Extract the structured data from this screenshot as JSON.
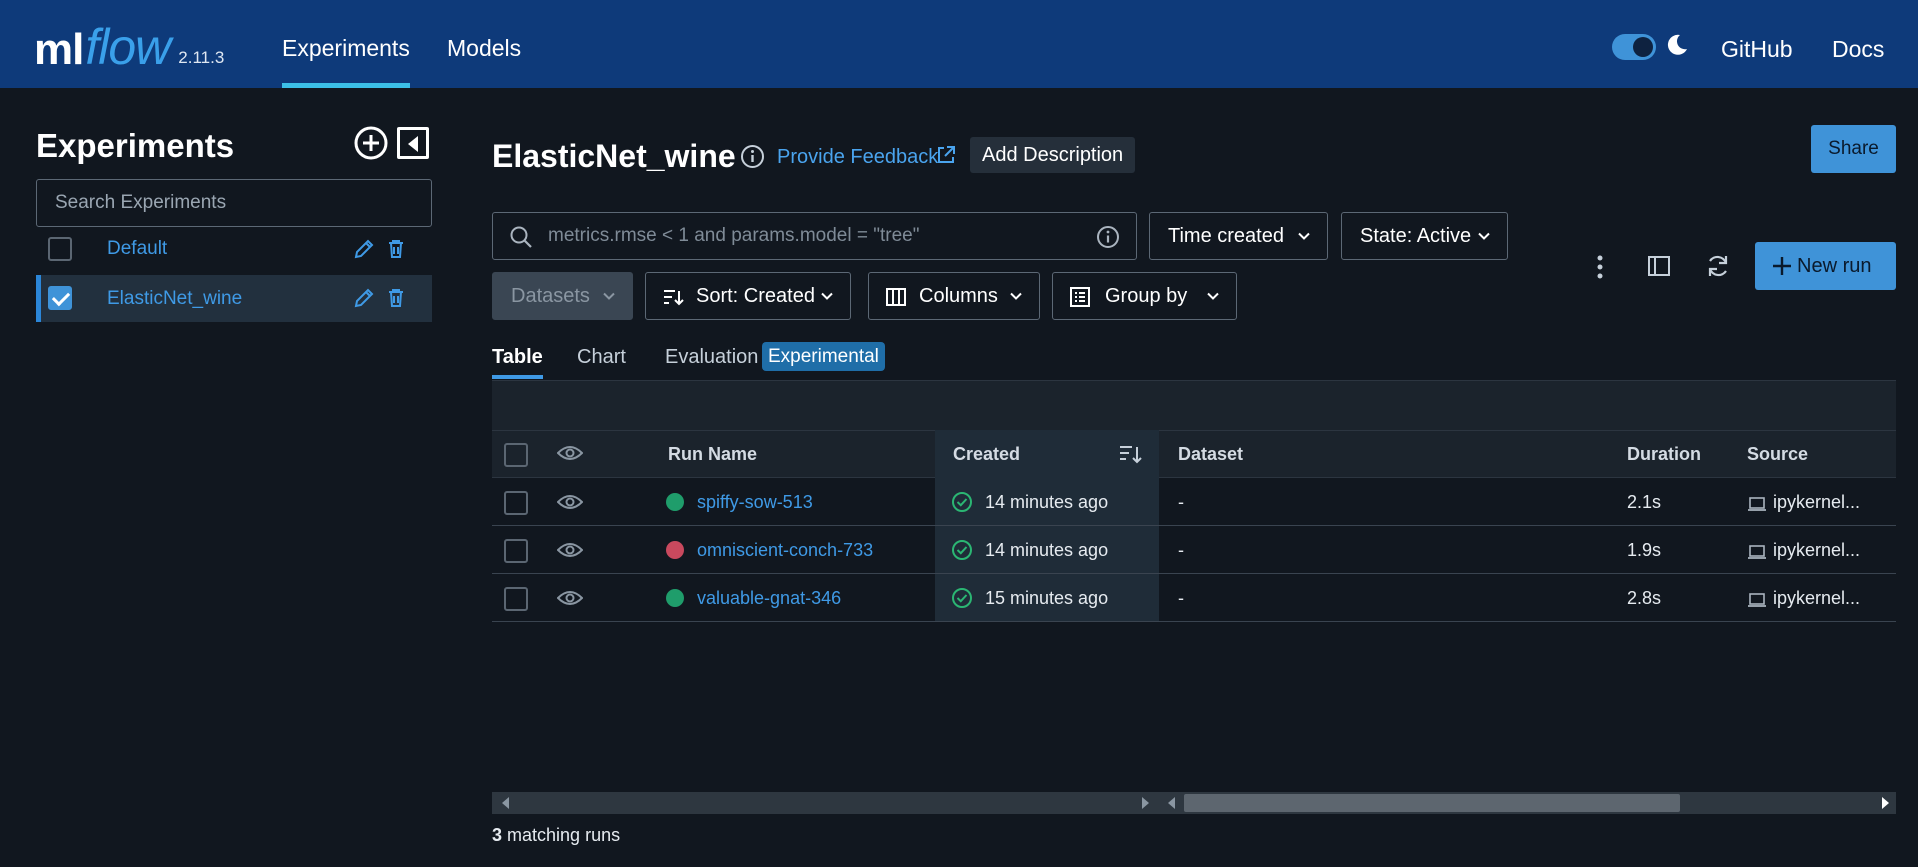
{
  "header": {
    "logo_ml": "ml",
    "logo_flow": "flow",
    "version": "2.11.3",
    "nav": [
      {
        "label": "Experiments",
        "active": true
      },
      {
        "label": "Models",
        "active": false
      }
    ],
    "dark_mode_toggle": true,
    "links": [
      {
        "label": "GitHub"
      },
      {
        "label": "Docs"
      }
    ]
  },
  "sidebar": {
    "title": "Experiments",
    "search_placeholder": "Search Experiments",
    "experiments": [
      {
        "name": "Default",
        "checked": false,
        "selected": false
      },
      {
        "name": "ElasticNet_wine",
        "checked": true,
        "selected": true
      }
    ]
  },
  "main": {
    "title": "ElasticNet_wine",
    "feedback_label": "Provide Feedback",
    "add_description_label": "Add Description",
    "share_label": "Share",
    "search_placeholder": "metrics.rmse < 1 and params.model = \"tree\"",
    "filters": {
      "time_created": "Time created",
      "state": "State: Active",
      "datasets": "Datasets",
      "sort": "Sort: Created",
      "columns": "Columns",
      "group_by": "Group by"
    },
    "new_run_label": "New run",
    "tabs": [
      {
        "label": "Table",
        "active": true
      },
      {
        "label": "Chart",
        "active": false
      },
      {
        "label": "Evaluation",
        "active": false
      }
    ],
    "experimental_badge": "Experimental",
    "table": {
      "columns": [
        "Run Name",
        "Created",
        "Dataset",
        "Duration",
        "Source"
      ],
      "rows": [
        {
          "status": "finished",
          "status_color": "#1f9d6b",
          "run_name": "spiffy-sow-513",
          "created": "14 minutes ago",
          "dataset": "-",
          "duration": "2.1s",
          "source": "ipykernel..."
        },
        {
          "status": "failed",
          "status_color": "#c9495e",
          "run_name": "omniscient-conch-733",
          "created": "14 minutes ago",
          "dataset": "-",
          "duration": "1.9s",
          "source": "ipykernel..."
        },
        {
          "status": "finished",
          "status_color": "#1f9d6b",
          "run_name": "valuable-gnat-346",
          "created": "15 minutes ago",
          "dataset": "-",
          "duration": "2.8s",
          "source": "ipykernel..."
        }
      ]
    },
    "matching_count": "3",
    "matching_label": "matching runs"
  },
  "colors": {
    "header_bg": "#0e3a7a",
    "page_bg": "#11171f",
    "accent": "#3f93d8",
    "link": "#3f9ae6",
    "success": "#1f9d6b",
    "failure": "#c9495e"
  },
  "icons": [
    "add-experiment-icon",
    "collapse-sidebar-icon",
    "edit-icon",
    "trash-icon",
    "info-icon",
    "external-link-icon",
    "search-icon",
    "chevron-down-icon",
    "sort-icon",
    "columns-icon",
    "group-by-icon",
    "more-vertical-icon",
    "side-panel-icon",
    "refresh-icon",
    "plus-icon",
    "eye-icon",
    "check-circle-icon",
    "laptop-icon",
    "moon-icon"
  ]
}
